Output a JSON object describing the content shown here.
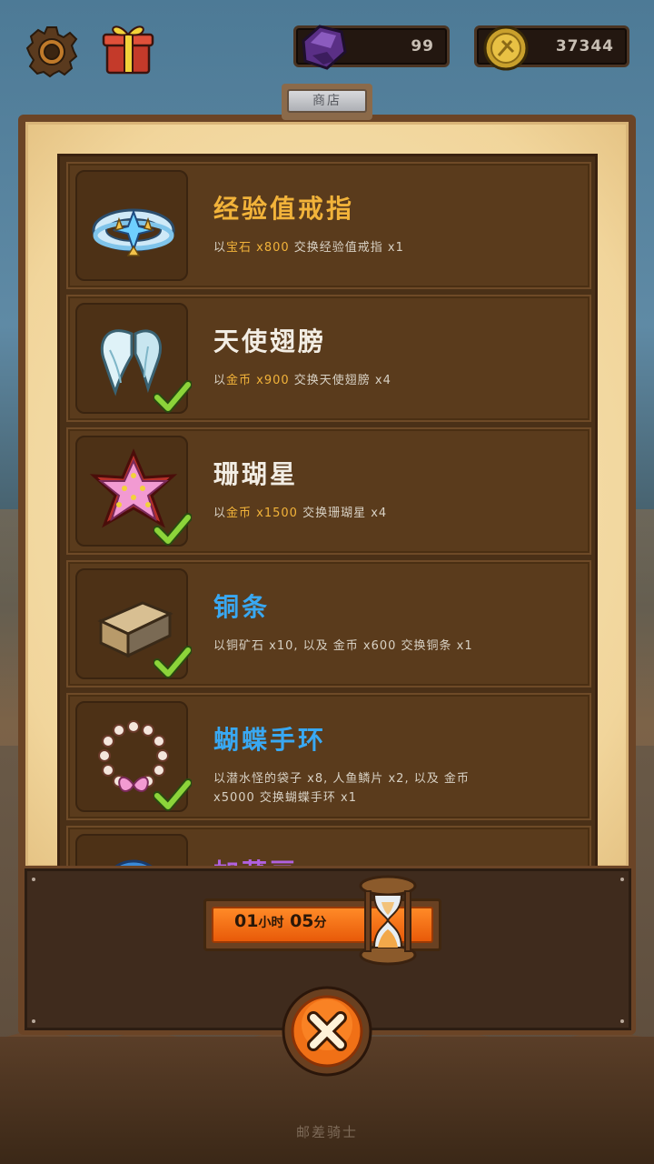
{
  "top_bar": {
    "gem_count": "99",
    "coin_count": "37344"
  },
  "shop": {
    "tab_label": "商店",
    "items": [
      {
        "name": "经验值戒指",
        "name_color": "gold",
        "desc_parts": [
          "以",
          "宝石",
          " x800",
          " 交换经验值戒指 x1"
        ],
        "owned": false,
        "icon": "ring-icon"
      },
      {
        "name": "天使翅膀",
        "name_color": "white",
        "desc_parts": [
          "以",
          "金币",
          " x900",
          " 交换天使翅膀 x4"
        ],
        "owned": true,
        "icon": "angel-wings-icon"
      },
      {
        "name": "珊瑚星",
        "name_color": "white",
        "desc_parts": [
          "以",
          "金币",
          " x1500",
          " 交换珊瑚星 x4"
        ],
        "owned": true,
        "icon": "coral-star-icon"
      },
      {
        "name": "铜条",
        "name_color": "blue",
        "desc_text": "以铜矿石 x10, 以及 金币 x600 交换铜条 x1",
        "owned": true,
        "icon": "copper-bar-icon"
      },
      {
        "name": "蝴蝶手环",
        "name_color": "blue",
        "desc_text_1": "以潜水怪的袋子 x8, 人鱼鳞片 x2, 以及 金币",
        "desc_text_2": "x5000 交换蝴蝶手环 x1",
        "owned": true,
        "icon": "butterfly-bracelet-icon"
      },
      {
        "name": "加菜豆",
        "name_color": "purple",
        "desc_text": "",
        "owned": false,
        "icon": "orb-icon"
      }
    ]
  },
  "timer": {
    "hours": "01",
    "hours_unit": "小时",
    "minutes": "05",
    "minutes_unit": "分"
  },
  "footer": {
    "text": "邮差骑士"
  },
  "colors": {
    "gold": "#f2b33a",
    "blue": "#39a8f2",
    "purple": "#b061e0",
    "panel_brown": "#5a3b1c",
    "timer_orange": "#f07016"
  }
}
